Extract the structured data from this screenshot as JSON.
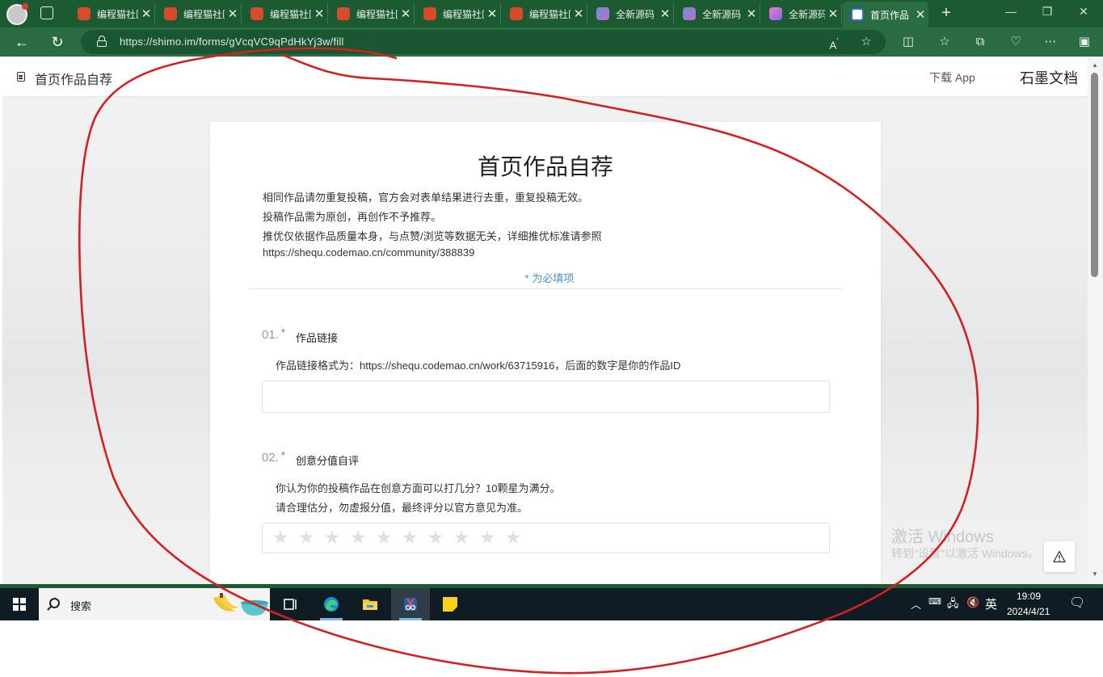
{
  "browser": {
    "tabs": [
      {
        "label": "编程猫社区",
        "icon": "codemao-favicon"
      },
      {
        "label": "编程猫社区",
        "icon": "codemao-favicon"
      },
      {
        "label": "编程猫社区",
        "icon": "codemao-favicon"
      },
      {
        "label": "编程猫社区",
        "icon": "codemao-favicon"
      },
      {
        "label": "编程猫社区",
        "icon": "codemao-favicon"
      },
      {
        "label": "编程猫社区",
        "icon": "codemao-favicon"
      },
      {
        "label": "全新源码",
        "icon": "app-favicon"
      },
      {
        "label": "全新源码",
        "icon": "app-favicon"
      },
      {
        "label": "全新源码",
        "icon": "app-favicon"
      },
      {
        "label": "首页作品",
        "icon": "shimo-favicon",
        "active": true
      }
    ],
    "new_tab": "+",
    "url": "https://shimo.im/forms/gVcqVC9qPdHkYj3w/fill",
    "colors": {
      "titlebar": "#1c5a32",
      "toolbar": "#2b6d42"
    }
  },
  "page_header": {
    "title": "首页作品自荐",
    "download_app": "下载 App",
    "brand": "石墨文档"
  },
  "form": {
    "title": "首页作品自荐",
    "description": [
      "相同作品请勿重复投稿，官方会对表单结果进行去重，重复投稿无效。",
      "投稿作品需为原创，再创作不予推荐。",
      "推优仅依据作品质量本身，与点赞/浏览等数据无关，详细推优标准请参照",
      "https://shequ.codemao.cn/community/388839"
    ],
    "required_note": "* 为必填项",
    "questions": [
      {
        "number": "01.",
        "required_mark": "*",
        "title": "作品链接",
        "description": [
          "作品链接格式为：https://shequ.codemao.cn/work/63715916，后面的数字是你的作品ID"
        ],
        "value": ""
      },
      {
        "number": "02.",
        "required_mark": "*",
        "title": "创意分值自评",
        "description": [
          "你认为你的投稿作品在创意方面可以打几分？10颗星为满分。",
          "请合理估分，勿虚报分值，最终评分以官方意见为准。"
        ],
        "rating_max": 10,
        "rating_value": 0
      }
    ]
  },
  "windows_watermark": {
    "line1": "激活 Windows",
    "line2": "转到\"设置\"以激活 Windows。"
  },
  "taskbar": {
    "search_label": "搜索",
    "clock_time": "19:09",
    "clock_date": "2024/4/21",
    "ime": "英",
    "apps": [
      "task-view",
      "edge",
      "file-explorer",
      "snipping-tool",
      "sticky-notes"
    ]
  },
  "annotation_color": "#d42020"
}
